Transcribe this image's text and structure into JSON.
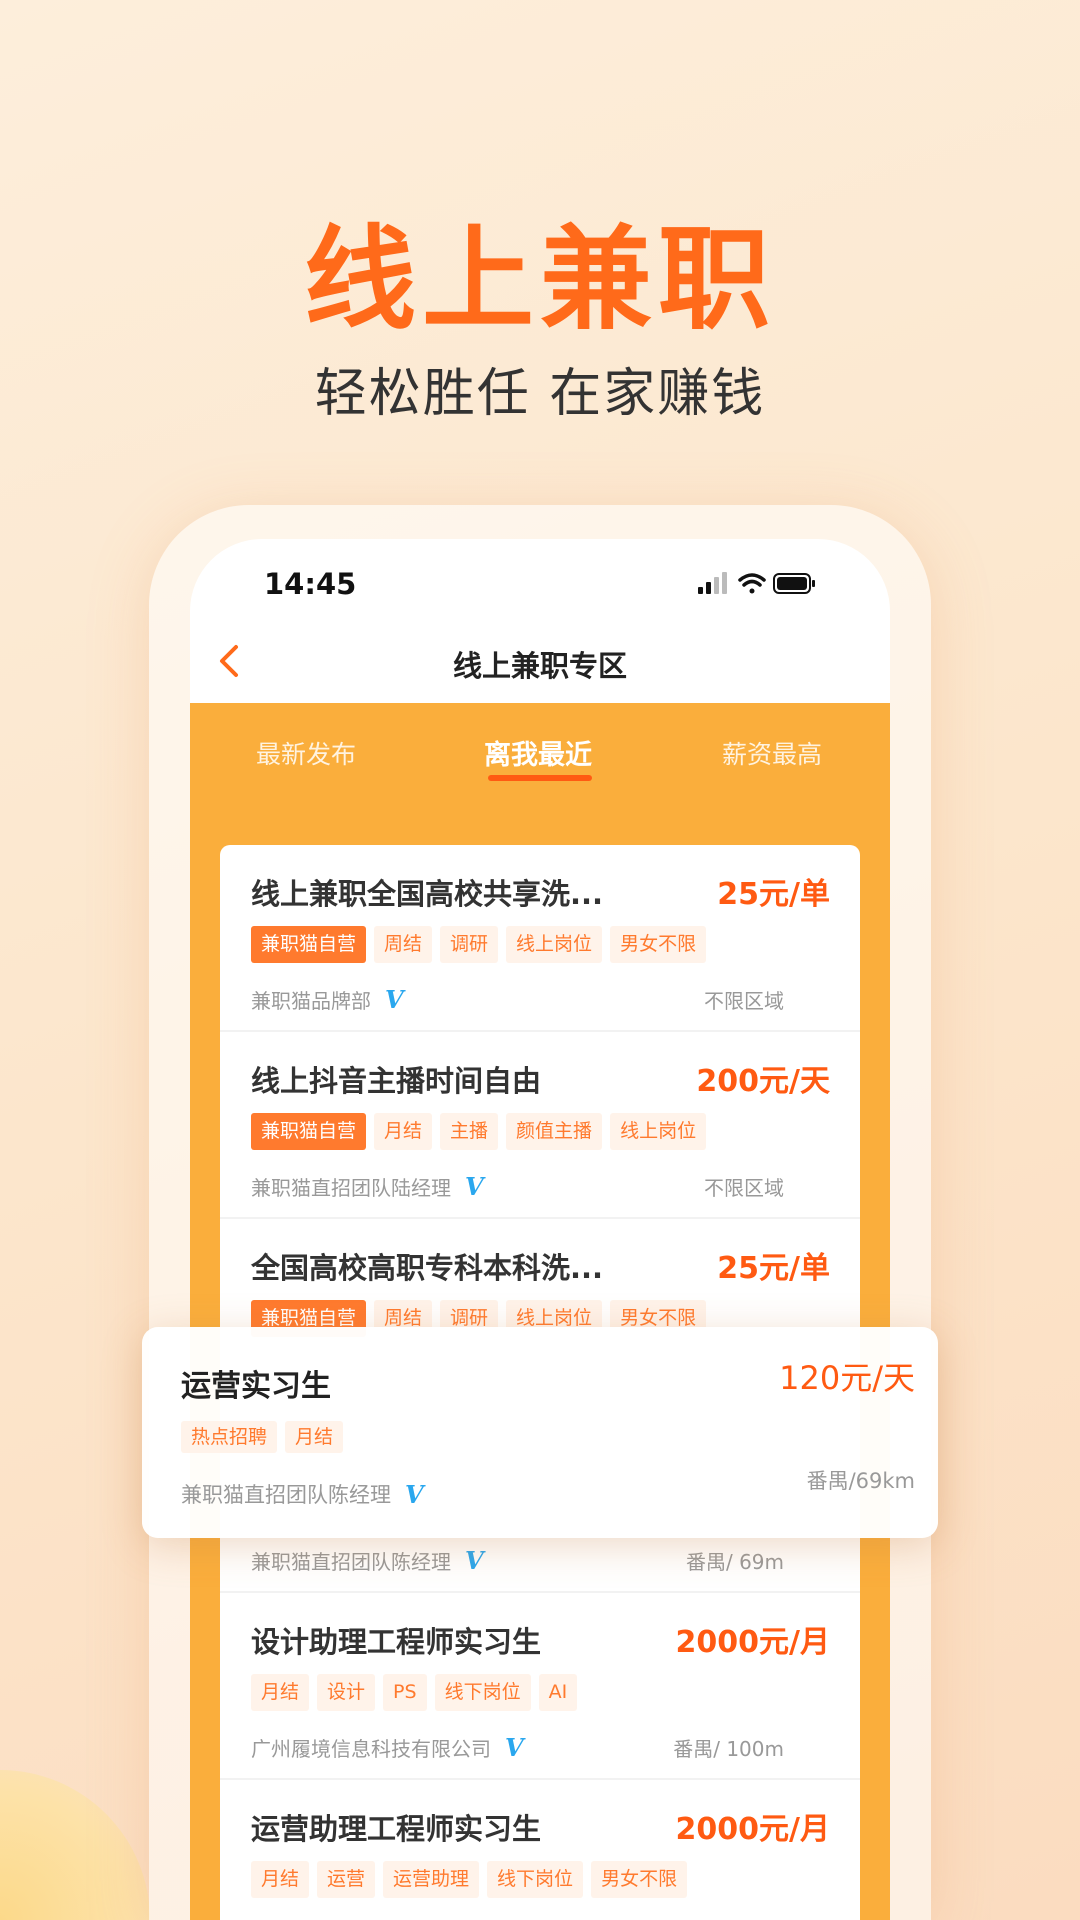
{
  "hero": {
    "title": "线上兼职",
    "subtitle": "轻松胜任 在家赚钱"
  },
  "status_bar": {
    "time": "14:45",
    "icons": [
      "signal-icon",
      "wifi-icon",
      "battery-icon"
    ]
  },
  "nav": {
    "title": "线上兼职专区",
    "back_icon": "chevron-left-icon"
  },
  "tabs": [
    {
      "label": "最新发布"
    },
    {
      "label": "离我最近",
      "active": true
    },
    {
      "label": "薪资最高"
    }
  ],
  "colors": {
    "accent": "#ff5a12",
    "band": "#faae3c",
    "verified": "#2aa7ee"
  },
  "jobs": [
    {
      "title": "线上兼职全国高校共享洗...",
      "price": "25元/单",
      "tags": [
        "兼职猫自营",
        "周结",
        "调研",
        "线上岗位",
        "男女不限"
      ],
      "company": "兼职猫品牌部",
      "location": "不限区域"
    },
    {
      "title": "线上抖音主播时间自由",
      "price": "200元/天",
      "tags": [
        "兼职猫自营",
        "月结",
        "主播",
        "颜值主播",
        "线上岗位"
      ],
      "company": "兼职猫直招团队陆经理",
      "location": "不限区域"
    },
    {
      "title": "全国高校高职专科本科洗...",
      "price": "25元/单",
      "tags": [
        "兼职猫自营",
        "周结",
        "调研",
        "线上岗位",
        "男女不限"
      ],
      "company": "",
      "location": ""
    },
    {
      "title": "",
      "price": "",
      "tags": [],
      "company": "兼职猫直招团队陈经理",
      "location": "番禺/ 69m"
    },
    {
      "title": "设计助理工程师实习生",
      "price": "2000元/月",
      "tags": [
        "月结",
        "设计",
        "PS",
        "线下岗位",
        "AI"
      ],
      "company": "广州履境信息科技有限公司",
      "location": "番禺/ 100m"
    },
    {
      "title": "运营助理工程师实习生",
      "price": "2000元/月",
      "tags": [
        "月结",
        "运营",
        "运营助理",
        "线下岗位",
        "男女不限"
      ],
      "company": "",
      "location": ""
    }
  ],
  "featured": {
    "title": "运营实习生",
    "price": "120元/天",
    "tags": [
      "热点招聘",
      "月结"
    ],
    "company": "兼职猫直招团队陈经理",
    "location": "番禺/69km"
  }
}
